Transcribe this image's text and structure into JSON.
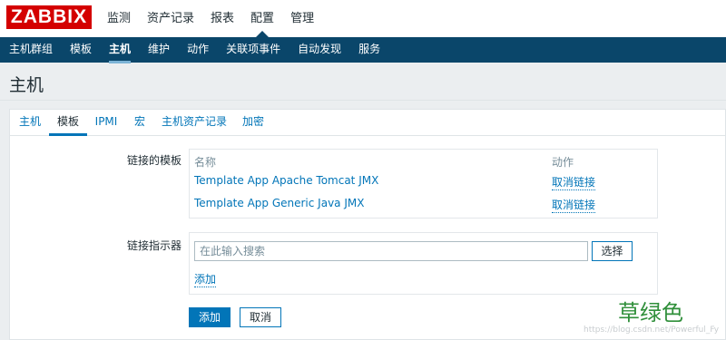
{
  "logo": "ZABBIX",
  "main_menu": [
    "监测",
    "资产记录",
    "报表",
    "配置",
    "管理"
  ],
  "sub_menu": [
    "主机群组",
    "模板",
    "主机",
    "维护",
    "动作",
    "关联项事件",
    "自动发现",
    "服务"
  ],
  "page_title": "主机",
  "tabs": [
    "主机",
    "模板",
    "IPMI",
    "宏",
    "主机资产记录",
    "加密"
  ],
  "linked_templates": {
    "label": "链接的模板",
    "col_name": "名称",
    "col_action": "动作",
    "rows": [
      {
        "name": "Template App Apache Tomcat JMX",
        "action": "取消链接"
      },
      {
        "name": "Template App Generic Java JMX",
        "action": "取消链接"
      }
    ]
  },
  "link_indicator": {
    "label": "链接指示器",
    "placeholder": "在此输入搜索",
    "select_label": "选择",
    "add_link": "添加"
  },
  "buttons": {
    "add": "添加",
    "cancel": "取消"
  },
  "watermark": "草绿色",
  "watermark_url": "https://blog.csdn.net/Powerful_Fy",
  "colors": {
    "logo": "#d40000",
    "submenu_bg": "#0a466a",
    "link": "#0275b8"
  }
}
